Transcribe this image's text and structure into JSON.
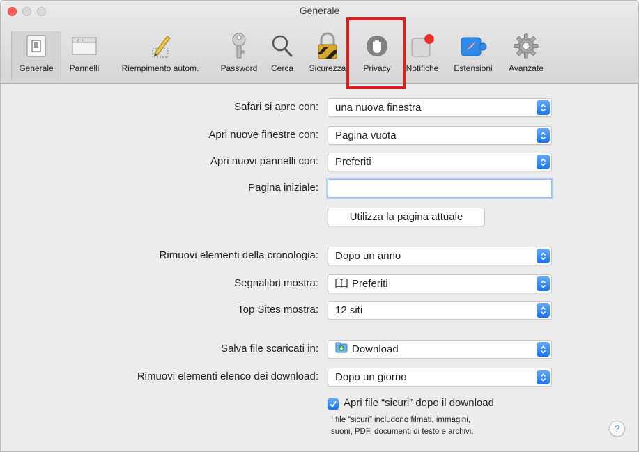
{
  "window": {
    "title": "Generale"
  },
  "toolbar": {
    "tabs": [
      {
        "label": "Generale",
        "icon": "switch-icon",
        "selected": true
      },
      {
        "label": "Pannelli",
        "icon": "tabs-icon"
      },
      {
        "label": "Riempimento autom.",
        "icon": "pencil-icon"
      },
      {
        "label": "Password",
        "icon": "key-icon"
      },
      {
        "label": "Cerca",
        "icon": "magnifier-icon"
      },
      {
        "label": "Sicurezza",
        "icon": "padlock-icon"
      },
      {
        "label": "Privacy",
        "icon": "hand-icon",
        "highlighted": true
      },
      {
        "label": "Notifiche",
        "icon": "notification-icon"
      },
      {
        "label": "Estensioni",
        "icon": "compass-icon"
      },
      {
        "label": "Avanzate",
        "icon": "gear-icon"
      }
    ],
    "highlight_color": "#e21d1d"
  },
  "settings": {
    "safari_opens_with": {
      "label": "Safari si apre con:",
      "value": "una nuova finestra"
    },
    "new_windows_open_with": {
      "label": "Apri nuove finestre con:",
      "value": "Pagina vuota"
    },
    "new_tabs_open_with": {
      "label": "Apri nuovi pannelli con:",
      "value": "Preferiti"
    },
    "homepage": {
      "label": "Pagina iniziale:",
      "value": ""
    },
    "use_current_page_button": "Utilizza la pagina attuale",
    "remove_history_items": {
      "label": "Rimuovi elementi della cronologia:",
      "value": "Dopo un anno"
    },
    "favorites_shows": {
      "label": "Segnalibri mostra:",
      "value": "Preferiti",
      "icon": "book-icon"
    },
    "top_sites_shows": {
      "label": "Top Sites mostra:",
      "value": "12 siti"
    },
    "download_location": {
      "label": "Salva file scaricati in:",
      "value": "Download",
      "icon": "download-folder-icon"
    },
    "remove_download_items": {
      "label": "Rimuovi elementi elenco dei download:",
      "value": "Dopo un giorno"
    },
    "open_safe_files": {
      "label": "Apri file “sicuri” dopo il download",
      "checked": true,
      "note_line1": "I file “sicuri” includono filmati, immagini,",
      "note_line2": "suoni, PDF, documenti di testo e archivi."
    },
    "help_button": "?"
  },
  "colors": {
    "accent": "#1a73e8",
    "close": "#fc605c"
  }
}
